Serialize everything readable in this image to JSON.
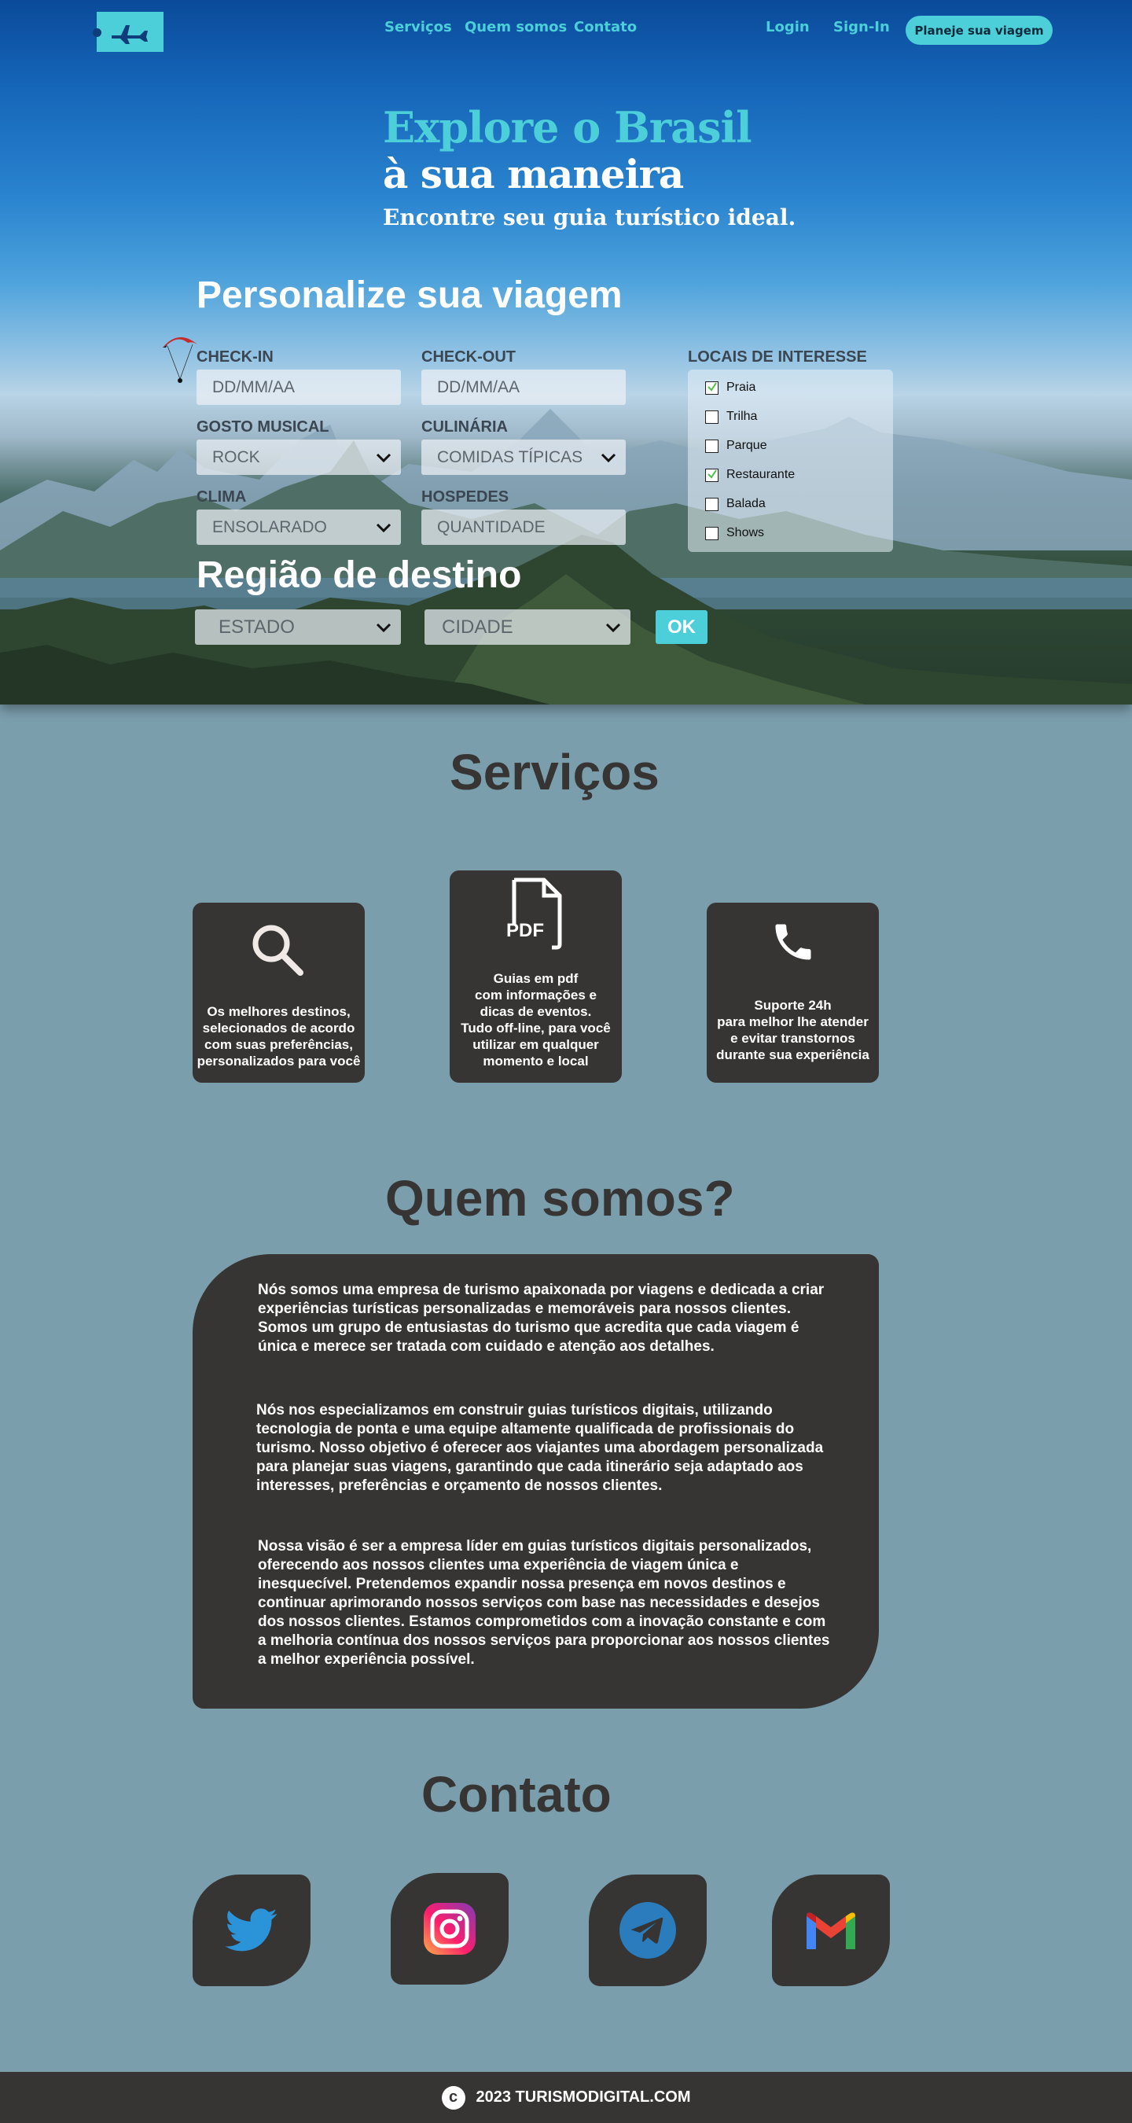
{
  "nav": {
    "links": [
      "Serviços",
      "Quem somos",
      "Contato"
    ],
    "login": "Login",
    "signin": "Sign-In",
    "cta": "Planeje sua viagem"
  },
  "hero": {
    "title_line1": "Explore o Brasil",
    "title_line2": "à sua maneira",
    "subtitle": "Encontre seu guia turístico ideal."
  },
  "form": {
    "title": "Personalize sua viagem",
    "checkin_label": "CHECK-IN",
    "checkin_placeholder": "DD/MM/AA",
    "checkout_label": "CHECK-OUT",
    "checkout_placeholder": "DD/MM/AA",
    "music_label": "GOSTO MUSICAL",
    "music_value": "ROCK",
    "food_label": "CULINÁRIA",
    "food_value": "COMIDAS TÍPICAS",
    "climate_label": "CLIMA",
    "climate_value": "ENSOLARADO",
    "guests_label": "HOSPEDES",
    "guests_placeholder": "QUANTIDADE",
    "interests_label": "LOCAIS DE INTERESSE",
    "interests": [
      {
        "label": "Praia",
        "checked": true
      },
      {
        "label": "Trilha",
        "checked": false
      },
      {
        "label": "Parque",
        "checked": false
      },
      {
        "label": "Restaurante",
        "checked": true
      },
      {
        "label": "Balada",
        "checked": false
      },
      {
        "label": "Shows",
        "checked": false
      }
    ]
  },
  "region": {
    "title": "Região de destino",
    "state_value": "ESTADO",
    "city_value": "CIDADE",
    "ok_label": "OK"
  },
  "services": {
    "title": "Serviços",
    "cards": [
      {
        "icon": "search-icon",
        "text": "Os melhores destinos,\nselecionados de acordo\ncom suas preferências,\npersonalizados para você"
      },
      {
        "icon": "pdf-icon",
        "text": "Guias em pdf\ncom informações e\ndicas de eventos.\nTudo off-line, para você\nutilizar em qualquer\nmomento e local"
      },
      {
        "icon": "phone-icon",
        "text": "Suporte 24h\npara melhor lhe atender\ne evitar transtornos\ndurante sua experiência"
      }
    ],
    "pdf_icon_text": "PDF"
  },
  "about": {
    "title": "Quem somos?",
    "paragraphs": [
      "Nós somos uma empresa de turismo apaixonada por viagens e dedicada a criar experiências turísticas personalizadas e memoráveis para nossos clientes. Somos um grupo de entusiastas do turismo que acredita que cada viagem é única e merece ser tratada com cuidado e atenção aos detalhes.",
      "Nós nos especializamos em construir guias turísticos digitais, utilizando tecnologia de ponta e uma equipe altamente qualificada de profissionais do turismo. Nosso objetivo é oferecer aos viajantes uma abordagem personalizada para planejar suas viagens, garantindo que cada itinerário seja adaptado aos interesses, preferências e orçamento de nossos clientes.",
      "Nossa visão é ser a empresa líder em guias turísticos digitais personalizados, oferecendo aos nossos clientes uma experiência de viagem única e inesquecível. Pretendemos expandir nossa presença em novos destinos e continuar aprimorando nossos serviços com base nas necessidades e desejos dos nossos clientes. Estamos comprometidos com a inovação constante e com a melhoria contínua dos nossos serviços para proporcionar aos nossos clientes a melhor experiência possível."
    ]
  },
  "contact": {
    "title": "Contato",
    "socials": [
      "twitter-icon",
      "instagram-icon",
      "telegram-icon",
      "gmail-icon"
    ]
  },
  "footer": {
    "symbol": "c",
    "text": "2023 TURISMODIGITAL.COM"
  },
  "colors": {
    "accent": "#4ccfd9",
    "dark": "#373534",
    "background": "#7b9ead"
  }
}
